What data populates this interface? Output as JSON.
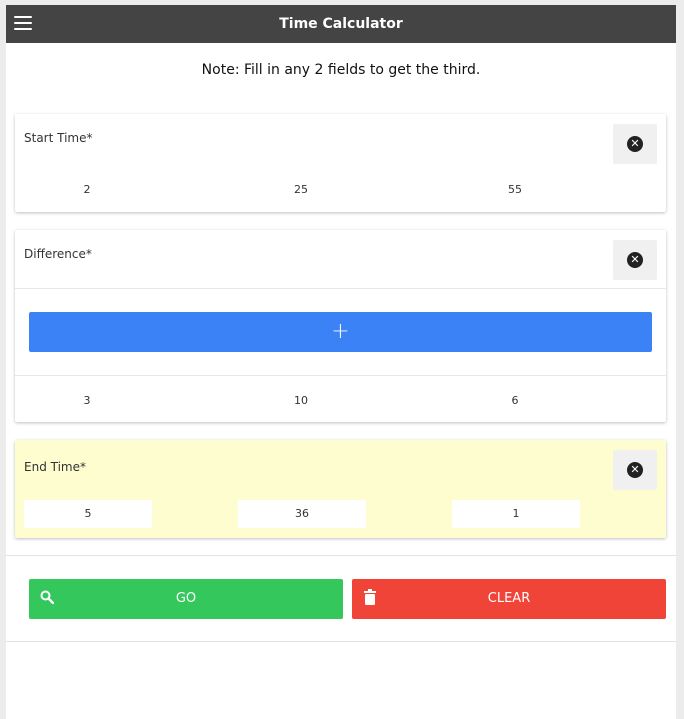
{
  "header": {
    "title": "Time Calculator",
    "menu_icon": "hamburger-menu-icon"
  },
  "note": "Note: Fill in any 2 fields to get the third.",
  "start_time": {
    "label": "Start Time*",
    "values": [
      "2",
      "25",
      "55"
    ]
  },
  "difference": {
    "label": "Difference*",
    "operator": "+",
    "values": [
      "3",
      "10",
      "6"
    ]
  },
  "end_time": {
    "label": "End Time*",
    "values": [
      "5",
      "36",
      "1"
    ],
    "background": "#fefdd0"
  },
  "actions": {
    "go_label": "GO",
    "clear_label": "CLEAR",
    "go_color": "#34c75c",
    "clear_color": "#f04438",
    "operator_color": "#3b82f6"
  }
}
